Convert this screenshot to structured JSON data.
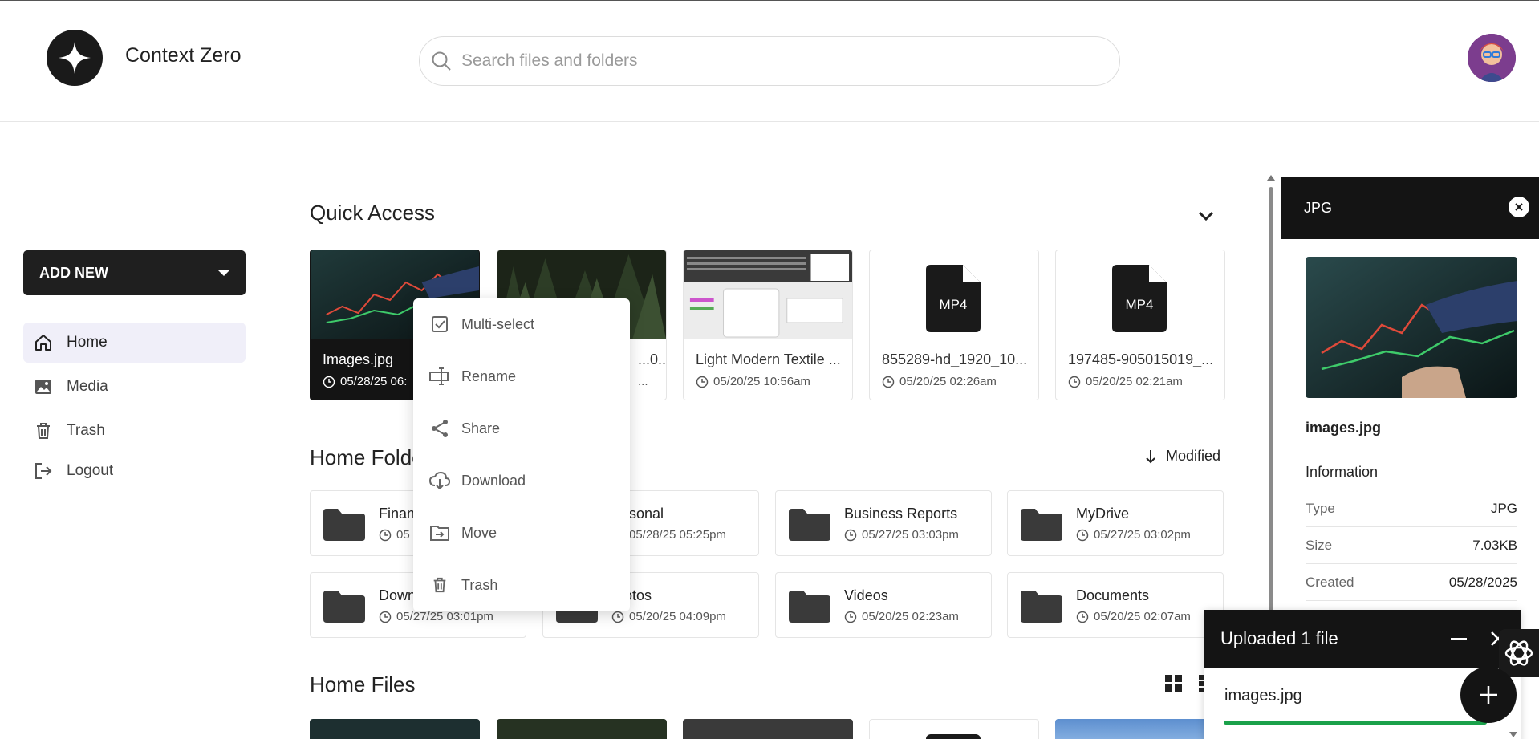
{
  "app": {
    "title": "Context Zero"
  },
  "search": {
    "placeholder": "Search files and folders"
  },
  "sidebar": {
    "add_new": "ADD NEW",
    "items": [
      {
        "label": "Home",
        "icon": "home-icon",
        "active": true
      },
      {
        "label": "Media",
        "icon": "image-icon"
      },
      {
        "label": "Trash",
        "icon": "trash-icon"
      },
      {
        "label": "Logout",
        "icon": "logout-icon"
      }
    ]
  },
  "quick_access": {
    "title": "Quick Access",
    "items": [
      {
        "name": "Images.jpg",
        "date": "05/28/25 06:",
        "thumb": "stock-chart-photo"
      },
      {
        "name": "...0...",
        "date": "...",
        "thumb": "forest-photo"
      },
      {
        "name": "Light Modern Textile ...",
        "date": "05/20/25 10:56am",
        "thumb": "document-screenshot"
      },
      {
        "name": "855289-hd_1920_10...",
        "date": "05/20/25 02:26am",
        "thumb": "MP4"
      },
      {
        "name": "197485-905015019_...",
        "date": "05/20/25 02:21am",
        "thumb": "MP4"
      }
    ]
  },
  "home_folders": {
    "title": "Home Folde",
    "sort_label": "Modified",
    "items": [
      {
        "name": "Finan",
        "date": "05"
      },
      {
        "name": "rsonal",
        "date": "05/28/25 05:25pm"
      },
      {
        "name": "Business Reports",
        "date": "05/27/25 03:03pm"
      },
      {
        "name": "MyDrive",
        "date": "05/27/25 03:02pm"
      },
      {
        "name": "Down",
        "date": "05/27/25 03:01pm"
      },
      {
        "name": "otos",
        "date": "05/20/25 04:09pm"
      },
      {
        "name": "Videos",
        "date": "05/20/25 02:23am"
      },
      {
        "name": "Documents",
        "date": "05/20/25 02:07am"
      }
    ]
  },
  "home_files": {
    "title": "Home Files"
  },
  "context_menu": {
    "items": [
      {
        "label": "Multi-select",
        "icon": "checkbox-icon"
      },
      {
        "label": "Rename",
        "icon": "rename-icon"
      },
      {
        "label": "Share",
        "icon": "share-icon"
      },
      {
        "label": "Download",
        "icon": "cloud-download-icon"
      },
      {
        "label": "Move",
        "icon": "folder-move-icon"
      },
      {
        "label": "Trash",
        "icon": "trash-icon"
      }
    ]
  },
  "details": {
    "header": "JPG",
    "filename": "images.jpg",
    "info_title": "Information",
    "rows": [
      {
        "k": "Type",
        "v": "JPG"
      },
      {
        "k": "Size",
        "v": "7.03KB"
      },
      {
        "k": "Created",
        "v": "05/28/2025"
      }
    ]
  },
  "upload": {
    "title": "Uploaded 1 file",
    "file": "images.jpg",
    "progress": 1.0,
    "color": "#1aa14a"
  }
}
